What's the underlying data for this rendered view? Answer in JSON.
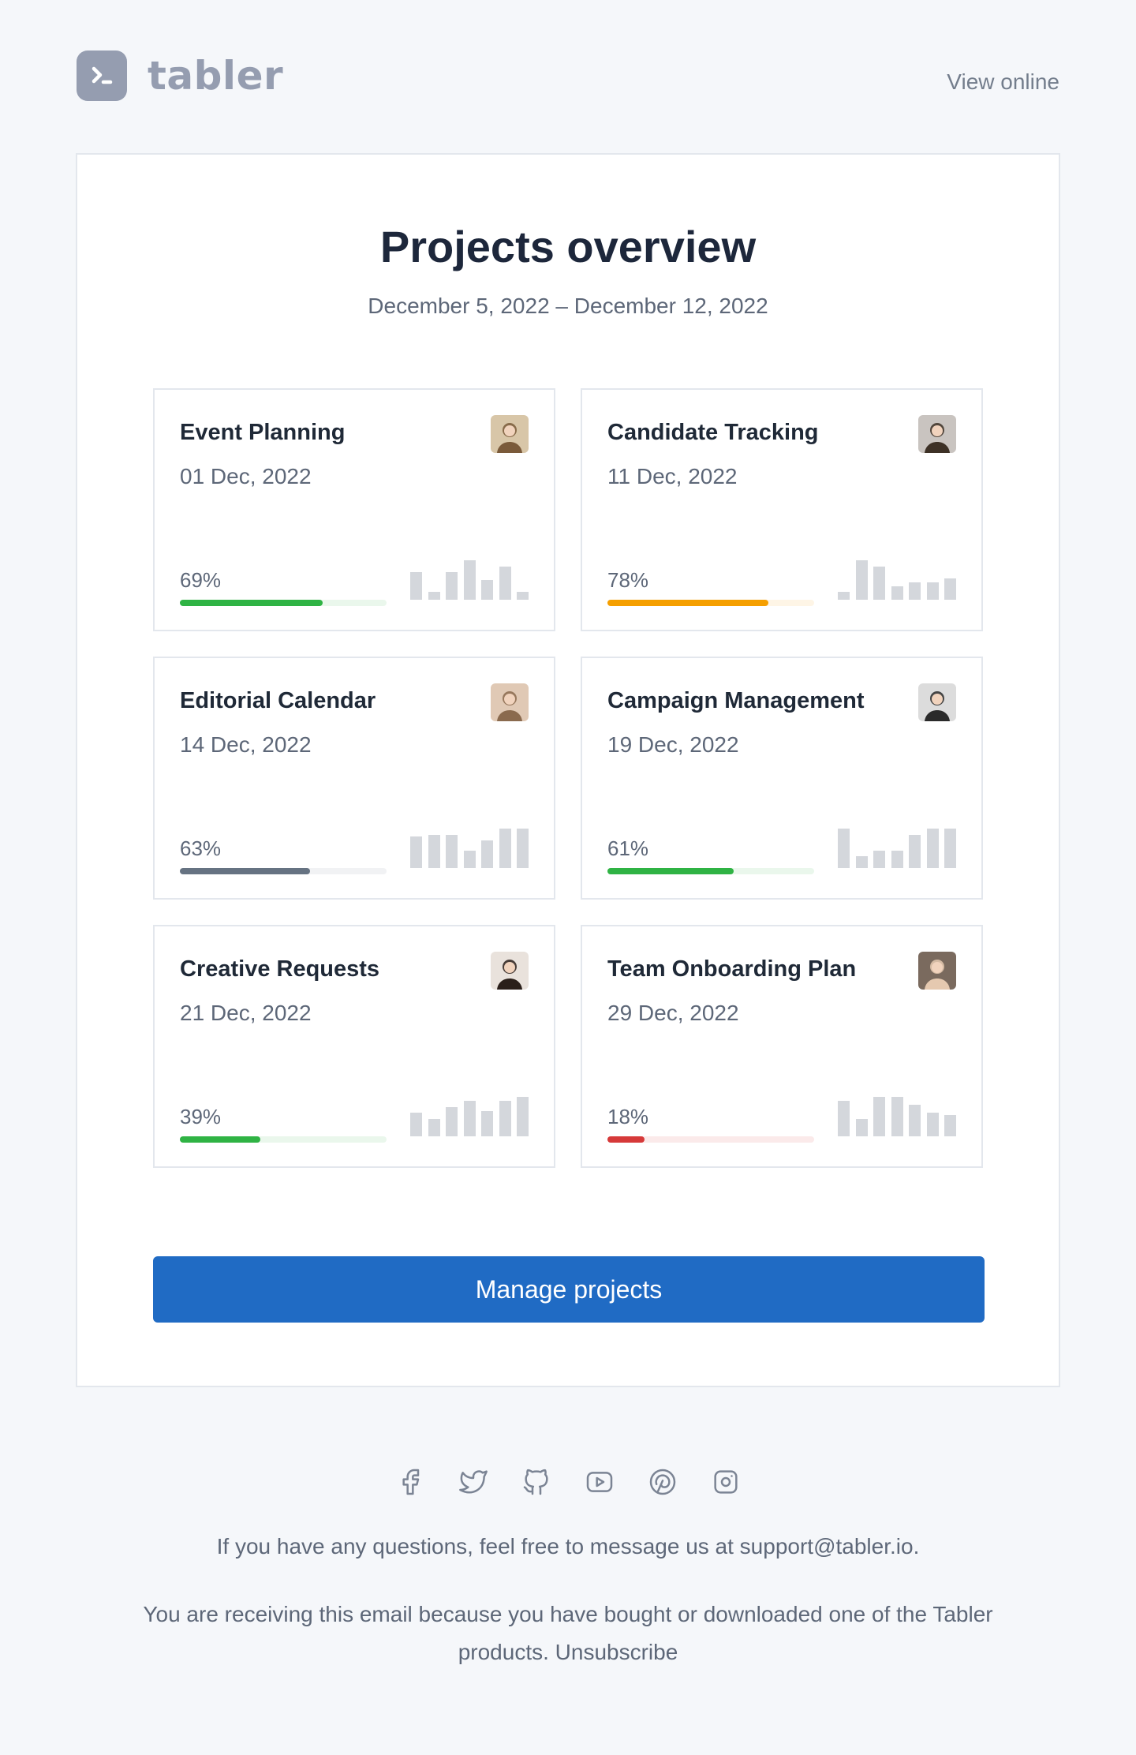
{
  "brand": {
    "name": "tabler",
    "view_online": "View online"
  },
  "card": {
    "title": "Projects overview",
    "date_range": "December 5, 2022 – December 12, 2022",
    "cta": "Manage projects"
  },
  "projects": [
    {
      "name": "Event Planning",
      "date": "01 Dec, 2022",
      "percent": "69%",
      "progress": 0.69,
      "color": "#2fb344",
      "track": "#eaf7ec",
      "bars": [
        0.7,
        0.2,
        0.7,
        1.0,
        0.5,
        0.85,
        0.2
      ],
      "avatar_bg": "#d8c6a8",
      "avatar_fg": "#7a5a3a"
    },
    {
      "name": "Candidate Tracking",
      "date": "11 Dec, 2022",
      "percent": "78%",
      "progress": 0.78,
      "color": "#f59f00",
      "track": "#fef5e6",
      "bars": [
        0.2,
        1.0,
        0.85,
        0.35,
        0.45,
        0.45,
        0.55
      ],
      "avatar_bg": "#c9c4c0",
      "avatar_fg": "#3d3126"
    },
    {
      "name": "Editorial Calendar",
      "date": "14 Dec, 2022",
      "percent": "63%",
      "progress": 0.63,
      "color": "#667382",
      "track": "#f1f2f4",
      "bars": [
        0.8,
        0.85,
        0.85,
        0.45,
        0.7,
        1.0,
        1.0
      ],
      "avatar_bg": "#e0c9b5",
      "avatar_fg": "#8a6a4e"
    },
    {
      "name": "Campaign Management",
      "date": "19 Dec, 2022",
      "percent": "61%",
      "progress": 0.61,
      "color": "#2fb344",
      "track": "#eaf7ec",
      "bars": [
        1.0,
        0.3,
        0.45,
        0.45,
        0.85,
        1.0,
        1.0
      ],
      "avatar_bg": "#dcdcdc",
      "avatar_fg": "#2a2a2a"
    },
    {
      "name": "Creative Requests",
      "date": "21 Dec, 2022",
      "percent": "39%",
      "progress": 0.39,
      "color": "#2fb344",
      "track": "#eaf7ec",
      "bars": [
        0.6,
        0.45,
        0.75,
        0.9,
        0.65,
        0.9,
        1.0
      ],
      "avatar_bg": "#e9e2dc",
      "avatar_fg": "#2a1f1a"
    },
    {
      "name": "Team Onboarding Plan",
      "date": "29 Dec, 2022",
      "percent": "18%",
      "progress": 0.18,
      "color": "#d63939",
      "track": "#fbeaea",
      "bars": [
        0.9,
        0.45,
        1.0,
        1.0,
        0.8,
        0.6,
        0.55
      ],
      "avatar_bg": "#7a6a5e",
      "avatar_fg": "#e5c9b0"
    }
  ],
  "social": [
    "facebook-icon",
    "twitter-icon",
    "github-icon",
    "youtube-icon",
    "pinterest-icon",
    "instagram-icon"
  ],
  "footer": {
    "question": "If you have any questions, feel free to message us at support@tabler.io.",
    "notice": "You are receiving this email because you have bought or downloaded one of the Tabler products.",
    "unsubscribe": "Unsubscribe"
  }
}
